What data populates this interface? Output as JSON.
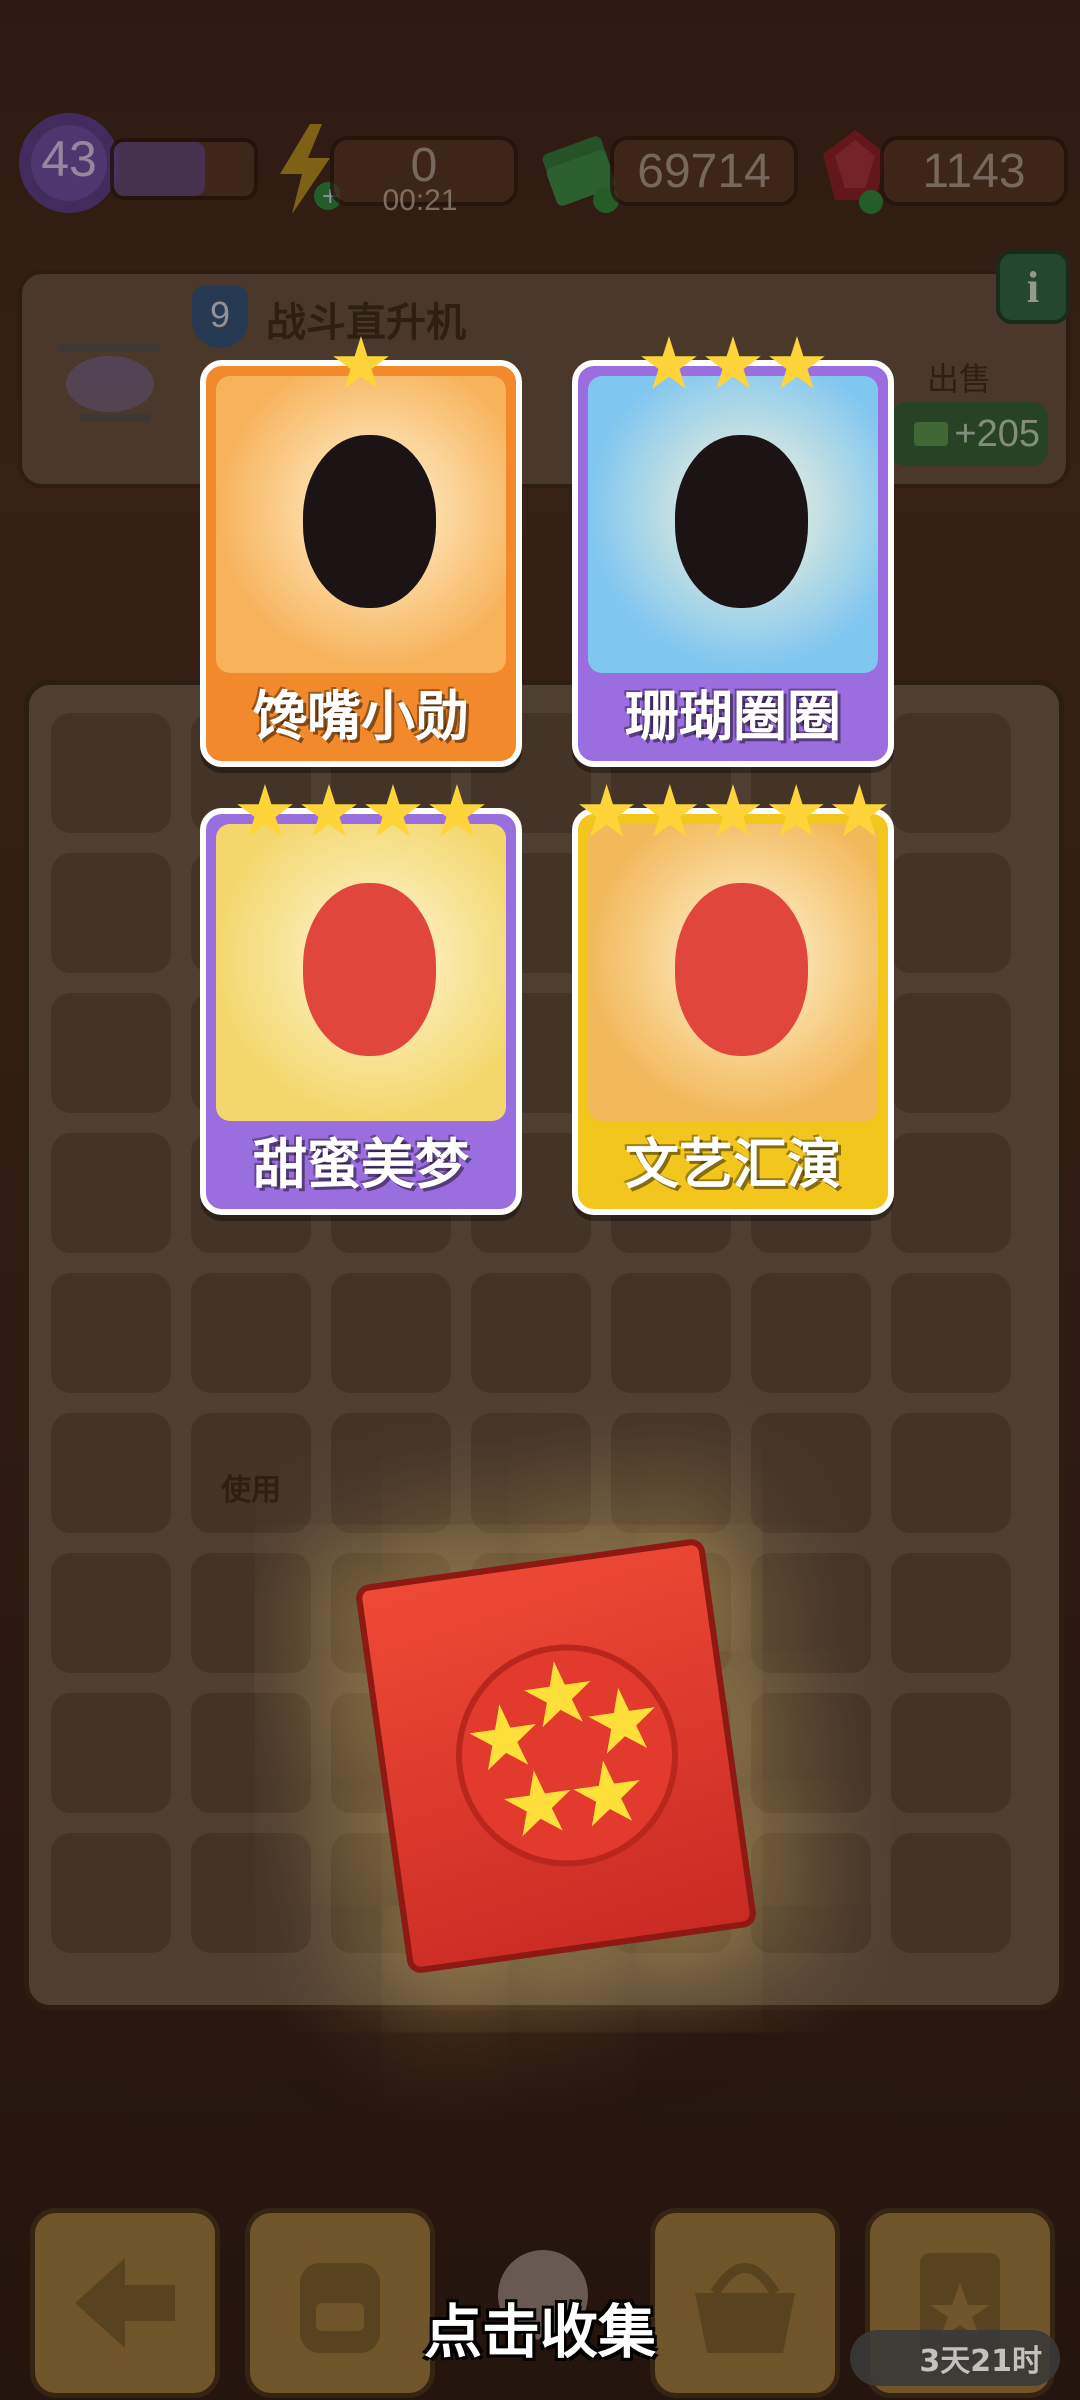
{
  "hud": {
    "level": "43",
    "energy": "0",
    "energy_timer": "00:21",
    "cash": "69714",
    "gems": "1143"
  },
  "item_panel": {
    "item_level": "9",
    "item_name": "战斗直升机",
    "sell_label": "出售",
    "sell_price": "+205",
    "info_icon": "i"
  },
  "cards": [
    {
      "name": "馋嘴小勋",
      "stars": 1,
      "color": "#f2892b"
    },
    {
      "name": "珊瑚圈圈",
      "stars": 3,
      "color": "#9b6ee0"
    },
    {
      "name": "甜蜜美梦",
      "stars": 4,
      "color": "#9b6ee0"
    },
    {
      "name": "文艺汇演",
      "stars": 5,
      "color": "#f2c61c"
    }
  ],
  "board": {
    "use_label": "使用"
  },
  "pack": {
    "stars": 5
  },
  "prompt": "点击收集",
  "event_timer": "3天21时",
  "colors": {
    "accent_gold": "#ffd43a",
    "pack_red": "#e23a2c",
    "gem_red": "#e0303a",
    "cash_green": "#3bb54a"
  }
}
